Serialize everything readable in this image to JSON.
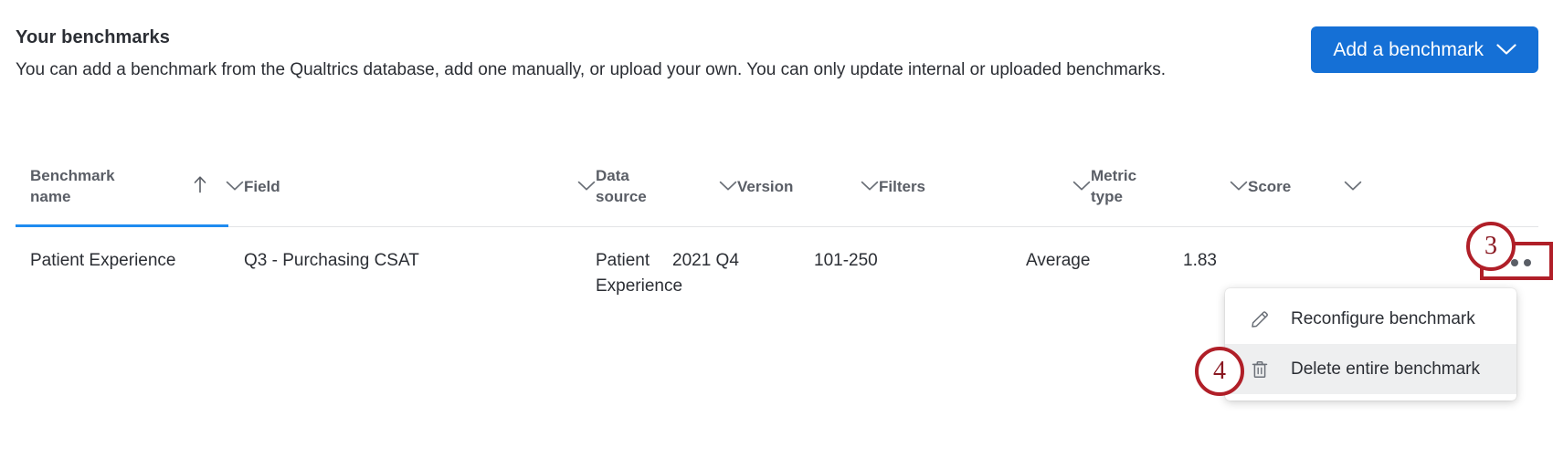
{
  "header": {
    "title": "Your benchmarks",
    "description": "You can add a benchmark from the Qualtrics database, add one manually, or upload your own. You can only update internal or uploaded benchmarks.",
    "add_button_label": "Add a benchmark",
    "add_button_icon": "chevron-down-icon",
    "accent_color": "#1570d6"
  },
  "table": {
    "columns": [
      {
        "label": "Benchmark name",
        "sort_icon": "sort-ascending-arrow-icon",
        "menu_icon": "chevron-down-icon",
        "sorted": true
      },
      {
        "label": "Field",
        "menu_icon": "chevron-down-icon",
        "sorted": false
      },
      {
        "label": "Data source",
        "menu_icon": "chevron-down-icon",
        "sorted": false
      },
      {
        "label": "Version",
        "menu_icon": "chevron-down-icon",
        "sorted": false
      },
      {
        "label": "Filters",
        "menu_icon": "chevron-down-icon",
        "sorted": false
      },
      {
        "label": "Metric type",
        "menu_icon": "chevron-down-icon",
        "sorted": false
      },
      {
        "label": "Score",
        "menu_icon": "chevron-down-icon",
        "sorted": false
      }
    ],
    "rows": [
      {
        "benchmark_name": "Patient Experience",
        "field": "Q3 - Purchasing CSAT",
        "data_source": "Patient Experience",
        "version": "2021 Q4",
        "filters": "101-250",
        "metric_type": "Average",
        "score": "1.83",
        "actions_icon": "ellipsis-horizontal-icon"
      }
    ],
    "sort_indicator_color": "#1f8bf0"
  },
  "context_menu": {
    "items": [
      {
        "label": "Reconfigure benchmark",
        "icon": "pencil-icon",
        "highlighted": false
      },
      {
        "label": "Delete entire benchmark",
        "icon": "trash-icon",
        "highlighted": true
      }
    ]
  },
  "annotations": {
    "color": "#b01f28",
    "markers": [
      {
        "number": "3",
        "target": "row-actions-ellipsis-button"
      },
      {
        "number": "4",
        "target": "delete-entire-benchmark-menu-item"
      }
    ]
  }
}
